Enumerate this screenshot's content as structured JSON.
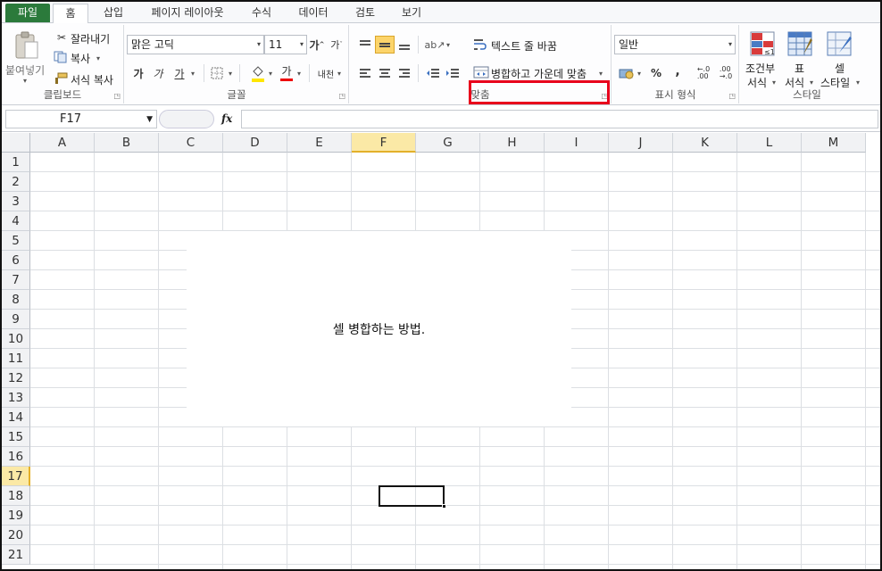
{
  "tabs": [
    "파일",
    "홈",
    "삽입",
    "페이지 레이아웃",
    "수식",
    "데이터",
    "검토",
    "보기"
  ],
  "clipboard": {
    "paste": "붙여넣기",
    "cut": "잘라내기",
    "copy": "복사",
    "format_painter": "서식 복사",
    "label": "클립보드"
  },
  "font": {
    "family": "맑은 고딕",
    "size": "11",
    "bold": "가",
    "italic": "가",
    "underline": "가",
    "font_color_glyph": "가",
    "phonetic": "내천",
    "label": "글꼴"
  },
  "alignment": {
    "wrap_text": "텍스트 줄 바꿈",
    "merge_center": "병합하고 가운데 맞춤",
    "label": "맞춤"
  },
  "number": {
    "format": "일반",
    "percent": "%",
    "comma": ",",
    "inc_decimal": ".0 .00",
    "dec_decimal": ".00 .0",
    "label": "표시 형식"
  },
  "styles": {
    "conditional_1": "조건부",
    "conditional_2": "서식",
    "table_1": "표",
    "table_2": "서식",
    "cell_1": "셀",
    "cell_2": "스타일",
    "label": "스타일"
  },
  "formula_bar": {
    "name_box": "F17",
    "fx": "fx",
    "value": ""
  },
  "columns": [
    "A",
    "B",
    "C",
    "D",
    "E",
    "F",
    "G",
    "H",
    "I",
    "J",
    "K",
    "L",
    "M"
  ],
  "rows": [
    "1",
    "2",
    "3",
    "4",
    "5",
    "6",
    "7",
    "8",
    "9",
    "10",
    "11",
    "12",
    "13",
    "14",
    "15",
    "16",
    "17",
    "18",
    "19",
    "20",
    "21"
  ],
  "selected_cell": {
    "col": "F",
    "row": "17"
  },
  "merged_cell_text": "셀 병합하는 방법.",
  "colors": {
    "file_tab": "#2b7a3b",
    "highlight": "#e8001c",
    "selected_header": "#fbe9a6"
  }
}
